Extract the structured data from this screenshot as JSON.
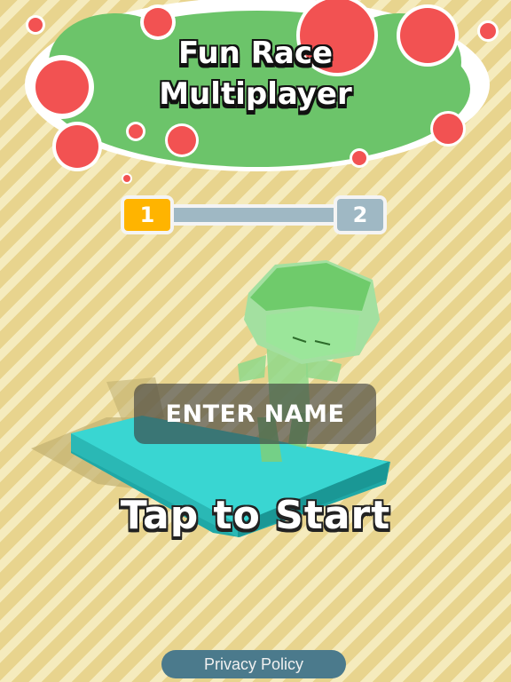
{
  "title": {
    "line1": "Fun Race",
    "line2": "Multiplayer"
  },
  "level_progress": {
    "current_level": "1",
    "next_level": "2",
    "progress": 0,
    "current_color": "#ffb400",
    "next_color": "#9fb8c4"
  },
  "name_button": {
    "label": "ENTER NAME"
  },
  "prompt": {
    "label": "Tap to Start"
  },
  "footer": {
    "privacy_label": "Privacy Policy"
  },
  "colors": {
    "cloud": "#6cc46a",
    "bubble": "#f25252",
    "platform": "#39d6d2",
    "character": "#8fd88a"
  }
}
